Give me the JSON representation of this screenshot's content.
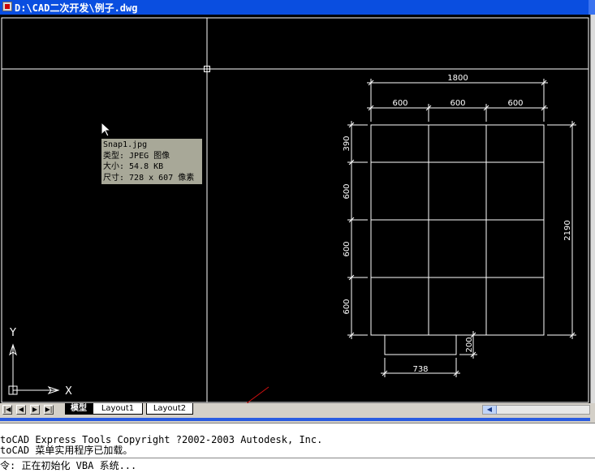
{
  "window": {
    "title": "D:\\CAD二次开发\\例子.dwg"
  },
  "tooltip": {
    "lines": [
      "Snap1.jpg",
      "类型: JPEG 图像",
      "大小: 54.8 KB",
      "尺寸: 728 x 607 像素"
    ]
  },
  "drawing": {
    "dimensions": {
      "total_width": "1800",
      "col1": "600",
      "col2": "600",
      "col3": "600",
      "row_top": "390",
      "row2": "600",
      "row3": "600",
      "row4": "600",
      "total_height": "2190",
      "base_height": "200",
      "base_width": "738"
    },
    "ucs": {
      "x_label": "X",
      "y_label": "Y"
    }
  },
  "tabs": {
    "model": "模型",
    "layout1": "Layout1",
    "layout2": "Layout2"
  },
  "command": {
    "line1": "toCAD Express Tools Copyright ?2002-2003 Autodesk, Inc.",
    "line2": "toCAD 菜单实用程序已加载。",
    "line3": "令: 正在初始化 VBA 系统..."
  }
}
